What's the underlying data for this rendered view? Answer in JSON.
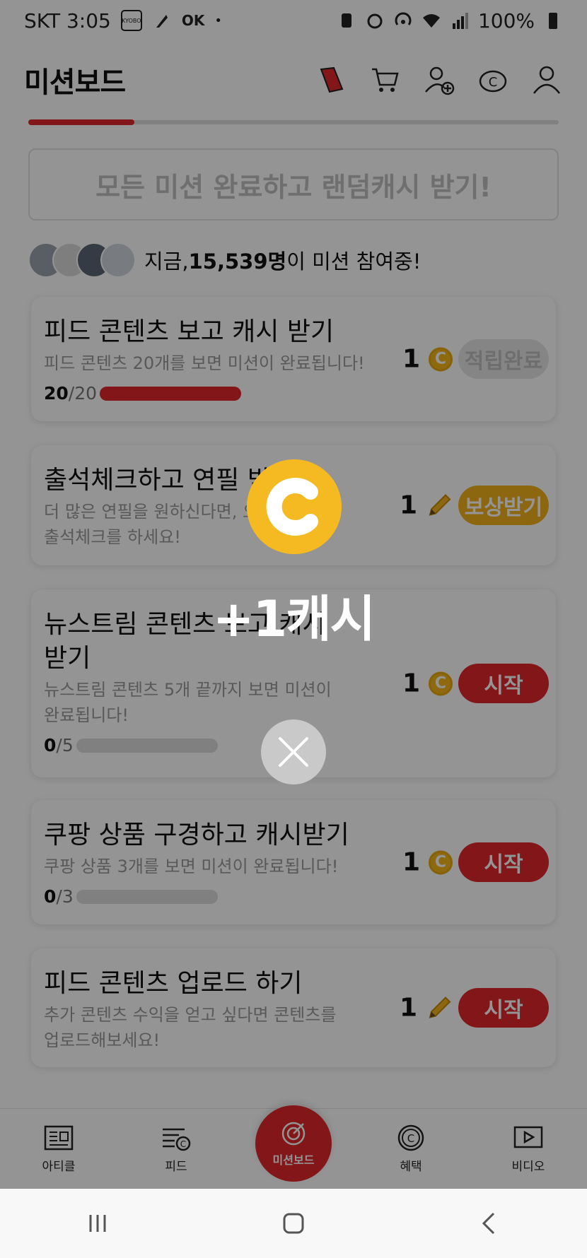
{
  "status_bar": {
    "carrier_time": "SKT 3:05",
    "battery": "100%"
  },
  "header": {
    "title": "미션보드"
  },
  "banner": {
    "text": "모든 미션 완료하고 랜덤캐시 받기!"
  },
  "participants": {
    "prefix": "지금, ",
    "count": "15,539명",
    "suffix": "이 미션 참여중!"
  },
  "missions": [
    {
      "title": "피드 콘텐츠 보고 캐시 받기",
      "desc": "피드 콘텐츠 20개를 보면 미션이 완료됩니다!",
      "progress_done": "20",
      "progress_total": "/20",
      "progress_ratio": 1.0,
      "reward": "1",
      "reward_icon": "coin-icon",
      "action": "적립완료",
      "action_color": "#e6e6e6",
      "action_text_color": "#bdbdbd"
    },
    {
      "title": "출석체크하고 연필 받기",
      "desc": "더 많은 연필을 원하신다면, 오늘 출석체크를 하세요!",
      "reward": "1",
      "reward_icon": "pencil-icon",
      "action": "보상받기",
      "action_color": "#f2b21b",
      "action_text_color": "#ffffff"
    },
    {
      "title": "뉴스트림 콘텐츠 보고 캐시 받기",
      "desc": "뉴스트림 콘텐츠 5개 끝까지 보면 미션이 완료됩니다!",
      "progress_done": "0",
      "progress_total": "/5",
      "progress_ratio": 0,
      "reward": "1",
      "reward_icon": "coin-icon",
      "action": "시작",
      "action_color": "#e0262b",
      "action_text_color": "#ffffff"
    },
    {
      "title": "쿠팡 상품 구경하고 캐시받기",
      "desc": "쿠팡 상품 3개를 보면 미션이 완료됩니다!",
      "progress_done": "0",
      "progress_total": "/3",
      "progress_ratio": 0,
      "reward": "1",
      "reward_icon": "coin-icon",
      "action": "시작",
      "action_color": "#e0262b",
      "action_text_color": "#ffffff"
    },
    {
      "title": "피드 콘텐츠 업로드 하기",
      "desc": "추가 콘텐츠 수익을 얻고 싶다면 콘텐츠를 업로드해보세요!",
      "reward": "1",
      "reward_icon": "pencil-icon",
      "action": "시작",
      "action_color": "#e0262b",
      "action_text_color": "#ffffff"
    }
  ],
  "bottom_nav": {
    "article": "아티클",
    "feed": "피드",
    "missionboard": "미션보드",
    "benefits": "혜택",
    "video": "비디오"
  },
  "popup": {
    "reward_text": "+1캐시",
    "coin_letter": "C"
  }
}
